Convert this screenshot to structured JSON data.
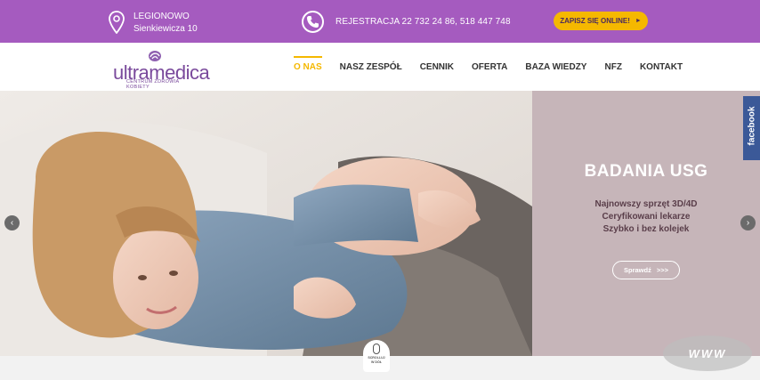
{
  "topbar": {
    "city": "LEGIONOWO",
    "street": "Sienkiewicza 10",
    "phone": "REJESTRACJA 22 732 24 86, 518 447 748",
    "cta_label": "ZAPISZ SIĘ ONLINE!",
    "cta_arrow": "►",
    "bg_color": "#a55bbf",
    "cta_color": "#f5b800"
  },
  "logo": {
    "word": "ultramedica",
    "tagline": "CENTRUM ZDROWIA KOBIETY"
  },
  "nav": {
    "items": [
      "O NAS",
      "NASZ ZESPÓŁ",
      "CENNIK",
      "OFERTA",
      "BAZA WIEDZY",
      "NFZ",
      "KONTAKT"
    ],
    "active": "O NAS"
  },
  "hero": {
    "title": "BADANIA USG",
    "lines": [
      "Najnowszy sprzęt 3D/4D",
      "Ceryfikowani lekarze",
      "Szybko i bez kolejek"
    ],
    "button_label": "Sprawdź",
    "button_arrows": ">>>",
    "prev_arrow": "‹",
    "next_arrow": "›"
  },
  "social": {
    "facebook_label": "facebook"
  },
  "scroll_hint": {
    "line1": "SCROLLUJ",
    "line2": "W DÓŁ"
  },
  "watermark": "WWW"
}
